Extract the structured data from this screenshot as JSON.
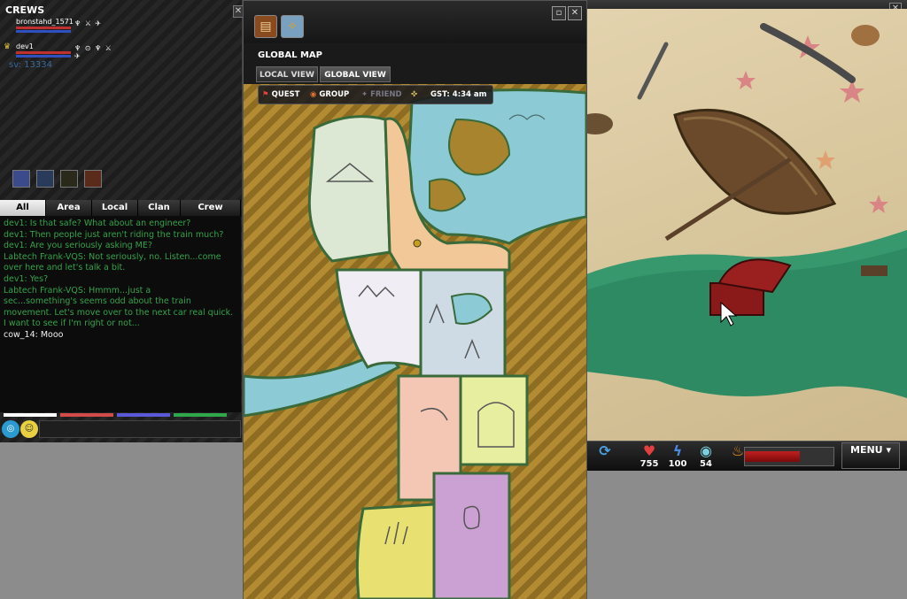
{
  "crews": {
    "title": "CREWS",
    "members": [
      {
        "name": "bronstahd_1571",
        "icons": "♆ ⚔ ✈"
      },
      {
        "name": "dev1",
        "icons": "♆ ⊙ ♆ ⚔ ✈"
      }
    ],
    "sv": "sv: 13334"
  },
  "chat": {
    "tabs": [
      "All",
      "Area",
      "Local",
      "Clan",
      "Crew"
    ],
    "active_tab": "All",
    "lines": [
      {
        "text": "dev1: Is that safe? What about an engineer?",
        "color": "green"
      },
      {
        "text": "dev1: Then people just aren't riding the train much?",
        "color": "green"
      },
      {
        "text": "dev1: Are you seriously asking ME?",
        "color": "green"
      },
      {
        "text": "Labtech Frank-VQS: Not seriously, no. Listen...come",
        "color": "green"
      },
      {
        "text": "over here and let's talk a bit.",
        "color": "green"
      },
      {
        "text": "dev1: Yes?",
        "color": "green"
      },
      {
        "text": "Labtech Frank-VQS: Hmmm...just a",
        "color": "green"
      },
      {
        "text": "sec...something's seems odd about the train",
        "color": "green"
      },
      {
        "text": "movement. Let's move over to the next car real quick.",
        "color": "green"
      },
      {
        "text": "I want to see if I'm right or not...",
        "color": "green"
      },
      {
        "text": "cow_14: Mooo",
        "color": "white"
      }
    ],
    "color_bars": [
      "#ffffff",
      "#d24a4a",
      "#5a5ad8",
      "#2ea84a"
    ]
  },
  "map": {
    "title": "GLOBAL MAP",
    "view_tabs": [
      "LOCAL VIEW",
      "GLOBAL VIEW"
    ],
    "active_view": "GLOBAL VIEW",
    "toolbar": {
      "quest": "QUEST",
      "group": "GROUP",
      "friend": "FRIEND",
      "gst": "GST: 4:34 am"
    }
  },
  "hud": {
    "health": "755",
    "energy": "100",
    "other": "54",
    "menu": "MENU",
    "bar_fill": 0.62
  },
  "colors": {
    "chat_green": "#34a24a",
    "map_stripe_a": "#b28b33",
    "map_stripe_b": "#8e6c22",
    "water": "#8ccbd6",
    "grass": "#2e8a62"
  }
}
